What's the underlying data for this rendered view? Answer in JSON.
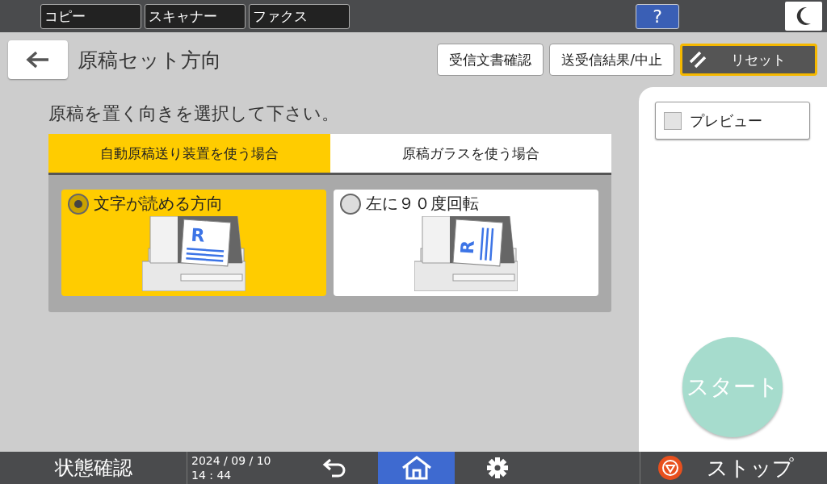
{
  "mode_tabs": [
    {
      "label": "コピー"
    },
    {
      "label": "スキャナー"
    },
    {
      "label": "ファクス"
    }
  ],
  "help_button": "?",
  "header": {
    "title": "原稿セット方向",
    "buttons": [
      {
        "label": "受信文書確認",
        "kind": "plain"
      },
      {
        "label": "送受信結果/中止",
        "kind": "plain"
      },
      {
        "label": "リセット",
        "kind": "reset"
      }
    ]
  },
  "instruction": "原稿を置く向きを選択して下さい。",
  "tabs": [
    {
      "label": "自動原稿送り装置を使う場合",
      "selected": true
    },
    {
      "label": "原稿ガラスを使う場合",
      "selected": false
    }
  ],
  "options": [
    {
      "label": "文字が読める方向",
      "selected": true,
      "kind": "upright",
      "paper_letter": "R"
    },
    {
      "label": "左に９０度回転",
      "selected": false,
      "kind": "rotated",
      "paper_letter": "R"
    }
  ],
  "preview": {
    "label": "プレビュー",
    "checked": false
  },
  "start_button": "スタート",
  "status_bar": {
    "status": "状態確認",
    "date": "2024 / 09 / 10",
    "time": "14 : 44",
    "stop": "ストップ"
  }
}
